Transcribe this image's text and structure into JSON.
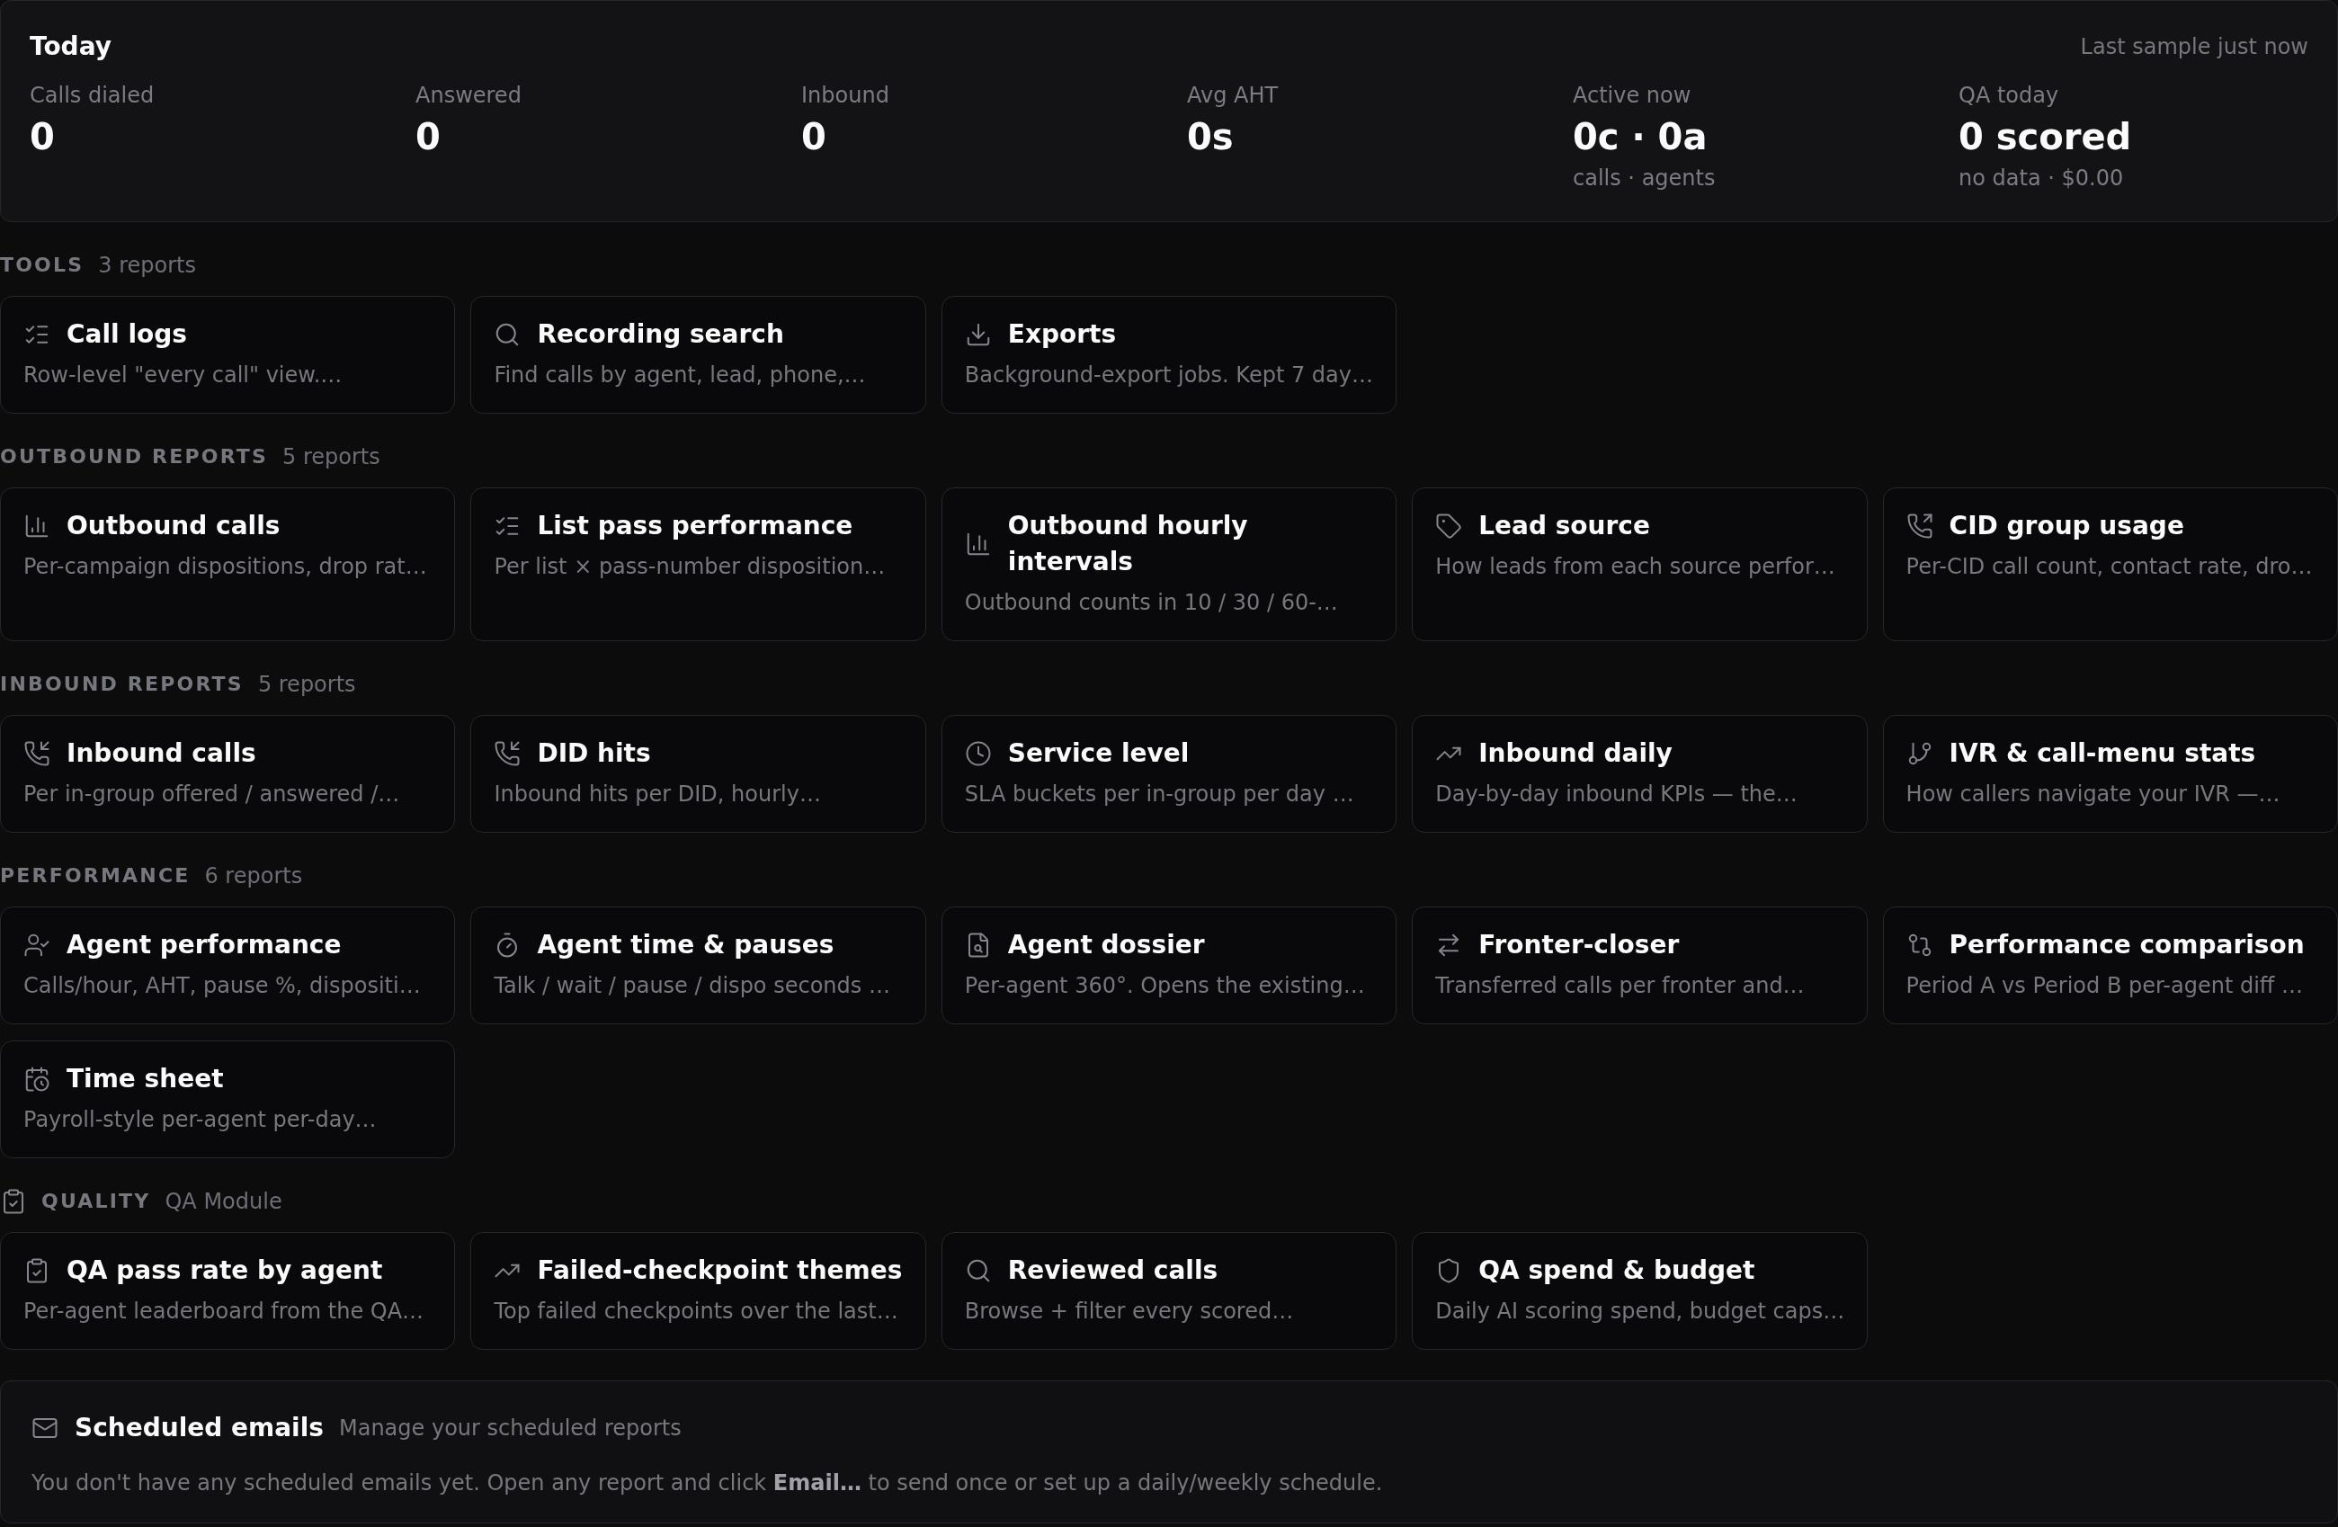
{
  "today": {
    "title": "Today",
    "last_sample": "Last sample just now",
    "stats": [
      {
        "label": "Calls dialed",
        "value": "0"
      },
      {
        "label": "Answered",
        "value": "0"
      },
      {
        "label": "Inbound",
        "value": "0"
      },
      {
        "label": "Avg AHT",
        "value": "0s"
      },
      {
        "label": "Active now",
        "value": "0c · 0a",
        "caption": "calls · agents"
      },
      {
        "label": "QA today",
        "value": "0 scored",
        "caption": "no data · $0.00"
      }
    ]
  },
  "sections": [
    {
      "title": "TOOLS",
      "subtitle": "3 reports",
      "reports": [
        {
          "title": "Call logs",
          "description": "Row-level \"every call\" view.…"
        },
        {
          "title": "Recording search",
          "description": "Find calls by agent, lead, phone,…"
        },
        {
          "title": "Exports",
          "description": "Background-export jobs. Kept 7 day…"
        }
      ]
    },
    {
      "title": "OUTBOUND REPORTS",
      "subtitle": "5 reports",
      "reports": [
        {
          "title": "Outbound calls",
          "description": "Per-campaign dispositions, drop rat…"
        },
        {
          "title": "List pass performance",
          "description": "Per list × pass-number disposition…"
        },
        {
          "title": "Outbound hourly intervals",
          "description": "Outbound counts in 10 / 30 / 60-…"
        },
        {
          "title": "Lead source",
          "description": "How leads from each source perfor…"
        },
        {
          "title": "CID group usage",
          "description": "Per-CID call count, contact rate, dro…"
        }
      ]
    },
    {
      "title": "INBOUND REPORTS",
      "subtitle": "5 reports",
      "reports": [
        {
          "title": "Inbound calls",
          "description": "Per in-group offered / answered /…"
        },
        {
          "title": "DID hits",
          "description": "Inbound hits per DID, hourly…"
        },
        {
          "title": "Service level",
          "description": "SLA buckets per in-group per day …"
        },
        {
          "title": "Inbound daily",
          "description": "Day-by-day inbound KPIs — the…"
        },
        {
          "title": "IVR & call-menu stats",
          "description": "How callers navigate your IVR —…"
        }
      ]
    },
    {
      "title": "PERFORMANCE",
      "subtitle": "6 reports",
      "reports": [
        {
          "title": "Agent performance",
          "description": "Calls/hour, AHT, pause %, dispositi…"
        },
        {
          "title": "Agent time & pauses",
          "description": "Talk / wait / pause / dispo seconds …"
        },
        {
          "title": "Agent dossier",
          "description": "Per-agent 360°. Opens the existing…"
        },
        {
          "title": "Fronter-closer",
          "description": "Transferred calls per fronter and…"
        },
        {
          "title": "Performance comparison",
          "description": "Period A vs Period B per-agent diff …"
        },
        {
          "title": "Time sheet",
          "description": "Payroll-style per-agent per-day…"
        }
      ]
    },
    {
      "title": "QUALITY",
      "subtitle": "QA Module",
      "reports": [
        {
          "title": "QA pass rate by agent",
          "description": "Per-agent leaderboard from the QA…"
        },
        {
          "title": "Failed-checkpoint themes",
          "description": "Top failed checkpoints over the last…"
        },
        {
          "title": "Reviewed calls",
          "description": "Browse + filter every scored…"
        },
        {
          "title": "QA spend & budget",
          "description": "Daily AI scoring spend, budget caps…"
        }
      ]
    }
  ],
  "scheduled_emails": {
    "title": "Scheduled emails",
    "subtitle": "Manage your scheduled reports",
    "message": "You don't have any scheduled emails yet. Open any report and click **Email…** to send once or set up a daily/weekly schedule."
  }
}
